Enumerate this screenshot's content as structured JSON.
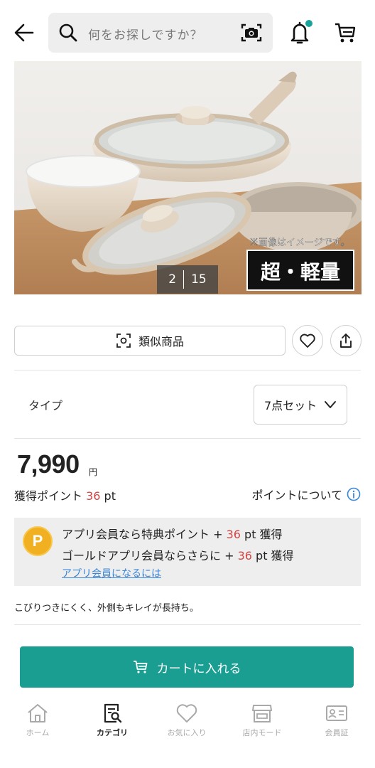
{
  "header": {
    "search_placeholder": "何をお探しですか？"
  },
  "gallery": {
    "current": "2",
    "total": "15",
    "overlay_note": "※画像はイメージです。",
    "overlay_badge": "超・軽量"
  },
  "actions": {
    "similar_label": "類似商品"
  },
  "type": {
    "label": "タイプ",
    "selected": "7点セット"
  },
  "price": {
    "value": "7,990",
    "unit": "円",
    "points_prefix": "獲得ポイント ",
    "points_value": "36",
    "points_suffix": " pt",
    "about_label": "ポイントについて"
  },
  "banner": {
    "badge": "P",
    "line1_text": "アプリ会員なら特典ポイント + ",
    "line1_value": "36",
    "line1_suffix": " pt 獲得",
    "line2_text": "ゴールドアプリ会員ならさらに + ",
    "line2_value": "36",
    "line2_suffix": " pt 獲得",
    "link": "アプリ会員になるには"
  },
  "description": "こびりつきにくく、外側もキレイが長持ち。",
  "cart_button_label": "カートに入れる",
  "bottom_nav": {
    "items": [
      {
        "label": "ホーム",
        "icon": "home-icon"
      },
      {
        "label": "カテゴリ",
        "icon": "category-search-icon",
        "active": true
      },
      {
        "label": "お気に入り",
        "icon": "heart-icon"
      },
      {
        "label": "店内モード",
        "icon": "store-icon"
      },
      {
        "label": "会員証",
        "icon": "member-card-icon"
      }
    ]
  },
  "colors": {
    "accent": "#1b9e92",
    "points_red": "#d14545",
    "link_blue": "#3a86d8",
    "badge_gold": "#f0b022"
  }
}
